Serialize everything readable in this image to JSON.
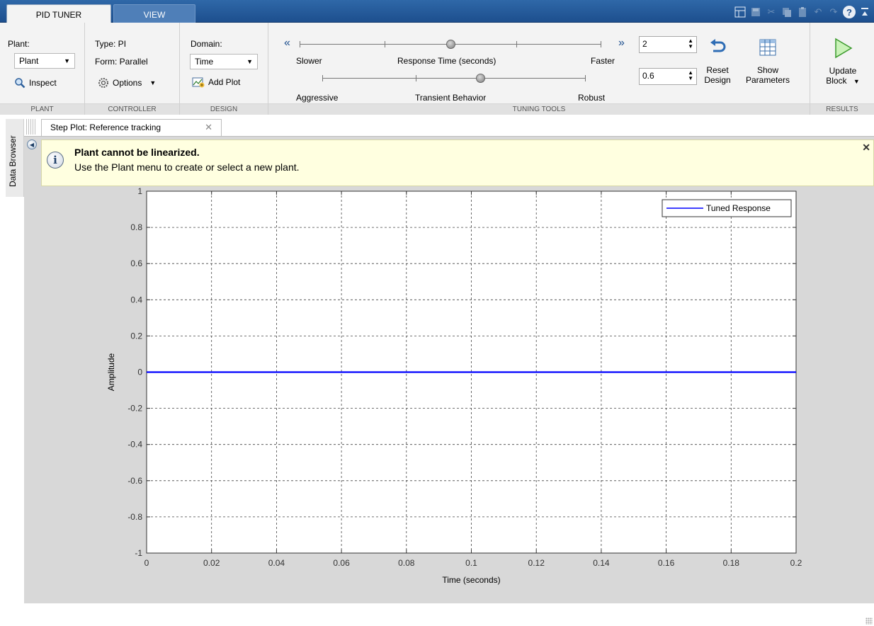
{
  "tabs": {
    "pid_tuner": "PID TUNER",
    "view": "VIEW"
  },
  "quick_access": [
    "layout-icon",
    "save-icon",
    "cut-icon",
    "copy-icon",
    "paste-icon",
    "undo-icon",
    "redo-icon",
    "help-icon",
    "collapse-ribbon-icon"
  ],
  "plant": {
    "label": "Plant:",
    "value": "Plant",
    "inspect": "Inspect",
    "section": "PLANT"
  },
  "controller": {
    "type": "Type: PI",
    "form": "Form: Parallel",
    "options": "Options",
    "section": "CONTROLLER"
  },
  "design": {
    "label": "Domain:",
    "domain": "Time",
    "add_plot": "Add Plot",
    "section": "DESIGN"
  },
  "tuning": {
    "slower": "Slower",
    "response_label": "Response Time (seconds)",
    "faster": "Faster",
    "aggressive": "Aggressive",
    "transient_label": "Transient Behavior",
    "robust": "Robust",
    "response_value": "2",
    "transient_value": "0.6",
    "response_slider": 0.5,
    "transient_slider": 0.6,
    "reset_line1": "Reset",
    "reset_line2": "Design",
    "show_line1": "Show",
    "show_line2": "Parameters",
    "section": "TUNING TOOLS"
  },
  "results": {
    "update_line1": "Update",
    "update_line2": "Block",
    "section": "RESULTS"
  },
  "sidebar": {
    "label": "Data Browser"
  },
  "document": {
    "tab_title": "Step Plot: Reference tracking"
  },
  "info": {
    "title": "Plant cannot be linearized.",
    "message": "Use the Plant menu to create or select a new plant."
  },
  "colors": {
    "series": "#0000ff",
    "accent": "#1d4f8e"
  },
  "chart_data": {
    "type": "line",
    "title": "",
    "xlabel": "Time (seconds)",
    "ylabel": "Amplitude",
    "xlim": [
      0,
      0.2
    ],
    "ylim": [
      -1,
      1
    ],
    "xticks": [
      0,
      0.02,
      0.04,
      0.06,
      0.08,
      0.1,
      0.12,
      0.14,
      0.16,
      0.18,
      0.2
    ],
    "xtick_labels": [
      "0",
      "0.02",
      "0.04",
      "0.06",
      "0.08",
      "0.1",
      "0.12",
      "0.14",
      "0.16",
      "0.18",
      "0.2"
    ],
    "yticks": [
      -1,
      -0.8,
      -0.6,
      -0.4,
      -0.2,
      0,
      0.2,
      0.4,
      0.6,
      0.8,
      1
    ],
    "ytick_labels": [
      "-1",
      "-0.8",
      "-0.6",
      "-0.4",
      "-0.2",
      "0",
      "0.2",
      "0.4",
      "0.6",
      "0.8",
      "1"
    ],
    "grid": true,
    "legend_position": "top-right",
    "series": [
      {
        "name": "Tuned Response",
        "x": [
          0,
          0.2
        ],
        "y": [
          0,
          0
        ]
      }
    ]
  }
}
